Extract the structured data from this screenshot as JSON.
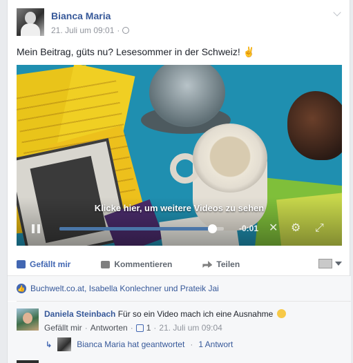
{
  "post": {
    "author": "Bianca Maria",
    "timestamp": "21. Juli um 09:01",
    "separator": "·",
    "text": "Mein Beitrag, güts nu? Lesesommer in der Schweiz!",
    "emoji": "✌",
    "privacy_icon": "globe-icon",
    "menu_icon": "chevron-down-icon"
  },
  "video": {
    "cta": "Klicke hier, um weitere Videos zu sehen",
    "time_remaining": "-0:01",
    "progress": 0.93,
    "icons": [
      "pause-icon",
      "mute-icon",
      "settings-icon",
      "fullscreen-icon"
    ]
  },
  "actions": {
    "like": "Gefällt mir",
    "comment": "Kommentieren",
    "share": "Teilen"
  },
  "likes": {
    "names": "Buchwelt.co.at, Isabella Konlechner und Prateik Jai"
  },
  "comment": {
    "author": "Daniela Steinbach",
    "text": "Für so ein Video mach ich eine Ausnahme",
    "like_link": "Gefällt mir",
    "reply_link": "Antworten",
    "like_count": "1",
    "timestamp": "21. Juli um 09:04",
    "dot": "·"
  },
  "reply": {
    "text": "Bianca Maria hat geantwortet",
    "dot": "·",
    "count": "1 Antwort"
  },
  "colors": {
    "link": "#365899",
    "accent": "#4267b2",
    "muted": "#90949c"
  }
}
